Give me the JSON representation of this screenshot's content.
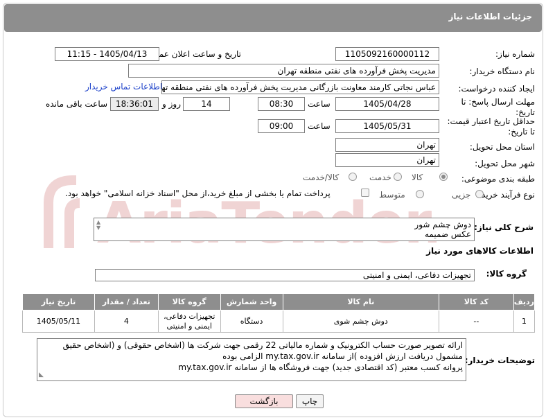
{
  "header": {
    "title": "جزئیات اطلاعات نیاز"
  },
  "fields": {
    "need_number_label": "شماره نیاز:",
    "need_number": "1105092160000112",
    "announce_label": "تاریخ و ساعت اعلان عمومی:",
    "announce_value": "1405/04/13 - 11:15",
    "buyer_org_label": "نام دستگاه خریدار:",
    "buyer_org": "مدیریت پخش فرآورده های نفتی منطقه تهران",
    "requester_label": "ایجاد کننده درخواست:",
    "requester": "عباس نجاتی کارمند معاونت بازرگانی مدیریت پخش فرآورده های نفتی منطقه تهران",
    "buyer_contact_link": "اطلاعات تماس خریدار",
    "reply_deadline_label_1": "مهلت ارسال پاسخ: تا",
    "reply_deadline_label_2": "تاریخ:",
    "reply_date": "1405/04/28",
    "time_word": "ساعت",
    "reply_time": "08:30",
    "days_value": "14",
    "days_word": "روز و",
    "remaining_time": "18:36:01",
    "remaining_word": "ساعت باقی مانده",
    "price_deadline_label_1": "حداقل تاریخ اعتبار قیمت:",
    "price_deadline_label_2": "تا تاریخ:",
    "price_date": "1405/05/31",
    "price_time": "09:00",
    "province_label": "استان محل تحویل:",
    "province": "تهران",
    "city_label": "شهر محل تحویل:",
    "city": "تهران",
    "category_label": "طبقه بندی موضوعی:",
    "category_options": [
      "کالا",
      "خدمت",
      "کالا/خدمت"
    ],
    "purchase_type_label": "نوع فرآیند خرید :",
    "purchase_type_options": [
      "جزیی",
      "متوسط"
    ],
    "payment_note": "پرداخت تمام یا بخشی از مبلغ خرید،از محل \"اسناد خزانه اسلامی\" خواهد بود."
  },
  "description": {
    "label": "شرح کلی نیاز:",
    "line1": "دوش چشم شور",
    "line2": "عکس ضمیمه"
  },
  "goods_info": {
    "title": "اطلاعات کالاهای مورد نیاز",
    "group_label": "گروه کالا:",
    "group_value": "تجهیزات دفاعی، ایمنی و امنیتی"
  },
  "table": {
    "headers": [
      "ردیف",
      "کد کالا",
      "نام کالا",
      "واحد شمارش",
      "گروه کالا",
      "تعداد / مقدار",
      "تاریخ نیاز"
    ],
    "rows": [
      {
        "row": "1",
        "code": "--",
        "name": "دوش چشم شوی",
        "unit": "دستگاه",
        "group": "تجهیزات دفاعی، ایمنی و امنیتی",
        "qty": "4",
        "date": "1405/05/11"
      }
    ]
  },
  "buyer_notes": {
    "label": "توضیحات خریدار:",
    "line1": "ارائه  تصویر صورت حساب الکترونیک و شماره مالیاتی 22 رقمی  جهت شرکت ها (اشخاص حقوقی) و (اشخاص حقیق",
    "line2": "مشمول دریافت ارزش افزوده )از سامانه my.tax.gov.ir  الزامی بوده",
    "line3": "پروانه کسب معتبر (کد اقتصادی جدید) جهت فروشگاه ها از سامانه my.tax.gov.ir"
  },
  "buttons": {
    "print": "چاپ",
    "back": "بازگشت"
  },
  "watermark": {
    "text": "AriaTender.net"
  },
  "colors": {
    "header": "#8e8e8e",
    "link": "#1a3fc9",
    "back_button_bg": "#f9dede",
    "watermark": "#e9c9c9"
  }
}
